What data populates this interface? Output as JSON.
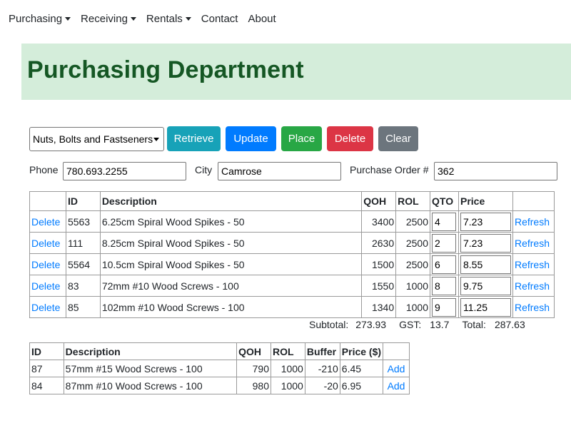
{
  "nav": {
    "items": [
      {
        "label": "Purchasing",
        "dropdown": true
      },
      {
        "label": "Receiving",
        "dropdown": true
      },
      {
        "label": "Rentals",
        "dropdown": true
      },
      {
        "label": "Contact",
        "dropdown": false
      },
      {
        "label": "About",
        "dropdown": false
      }
    ]
  },
  "header": {
    "title": "Purchasing Department"
  },
  "toolbar": {
    "vendor_selected": "Nuts, Bolts and Fastseners",
    "retrieve_label": "Retrieve",
    "update_label": "Update",
    "place_label": "Place",
    "delete_label": "Delete",
    "clear_label": "Clear"
  },
  "info": {
    "phone_label": "Phone",
    "phone_value": "780.693.2255",
    "city_label": "City",
    "city_value": "Camrose",
    "po_label": "Purchase Order #",
    "po_value": "362"
  },
  "order_table": {
    "headers": [
      "",
      "ID",
      "Description",
      "QOH",
      "ROL",
      "QTO",
      "Price",
      ""
    ],
    "rows": [
      {
        "action": "Delete",
        "id": "5563",
        "description": "6.25cm Spiral Wood Spikes - 50",
        "qoh": "3400",
        "rol": "2500",
        "qto": "4",
        "price": "7.23",
        "refresh": "Refresh"
      },
      {
        "action": "Delete",
        "id": "111",
        "description": "8.25cm Spiral Wood Spikes - 50",
        "qoh": "2630",
        "rol": "2500",
        "qto": "2",
        "price": "7.23",
        "refresh": "Refresh"
      },
      {
        "action": "Delete",
        "id": "5564",
        "description": "10.5cm Spiral Wood Spikes - 50",
        "qoh": "1500",
        "rol": "2500",
        "qto": "6",
        "price": "8.55",
        "refresh": "Refresh"
      },
      {
        "action": "Delete",
        "id": "83",
        "description": "72mm #10 Wood Screws - 100",
        "qoh": "1550",
        "rol": "1000",
        "qto": "8",
        "price": "9.75",
        "refresh": "Refresh"
      },
      {
        "action": "Delete",
        "id": "85",
        "description": "102mm #10 Wood Screws - 100",
        "qoh": "1340",
        "rol": "1000",
        "qto": "9",
        "price": "11.25",
        "refresh": "Refresh"
      }
    ]
  },
  "totals": {
    "subtotal_label": "Subtotal:",
    "subtotal_value": "273.93",
    "gst_label": "GST:",
    "gst_value": "13.7",
    "total_label": "Total:",
    "total_value": "287.63"
  },
  "inventory_table": {
    "headers": [
      "ID",
      "Description",
      "QOH",
      "ROL",
      "Buffer",
      "Price ($)",
      ""
    ],
    "rows": [
      {
        "id": "87",
        "description": "57mm #15 Wood Screws - 100",
        "qoh": "790",
        "rol": "1000",
        "buffer": "-210",
        "price": "6.45",
        "action": "Add"
      },
      {
        "id": "84",
        "description": "87mm #10 Wood Screws - 100",
        "qoh": "980",
        "rol": "1000",
        "buffer": "-20",
        "price": "6.95",
        "action": "Add"
      }
    ]
  }
}
